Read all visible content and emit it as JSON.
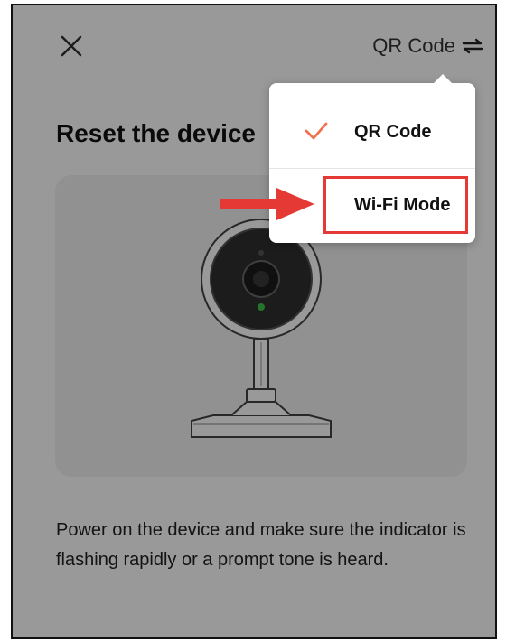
{
  "header": {
    "close_icon": "close-icon",
    "mode_label": "QR Code",
    "switch_icon": "switch-arrows-icon"
  },
  "title": "Reset the device",
  "description": "Power on the device and make sure the indicator is flashing rapidly or a prompt tone is heard.",
  "menu": {
    "items": [
      {
        "label": "QR Code",
        "selected": true,
        "icon": "check-icon"
      },
      {
        "label": "Wi-Fi Mode",
        "selected": false,
        "highlighted": true
      }
    ]
  },
  "colors": {
    "accent_check": "#f07350",
    "highlight_red": "#e53935",
    "indicator_green": "#3cc24a",
    "overlay": "rgba(0,0,0,0.40)"
  }
}
